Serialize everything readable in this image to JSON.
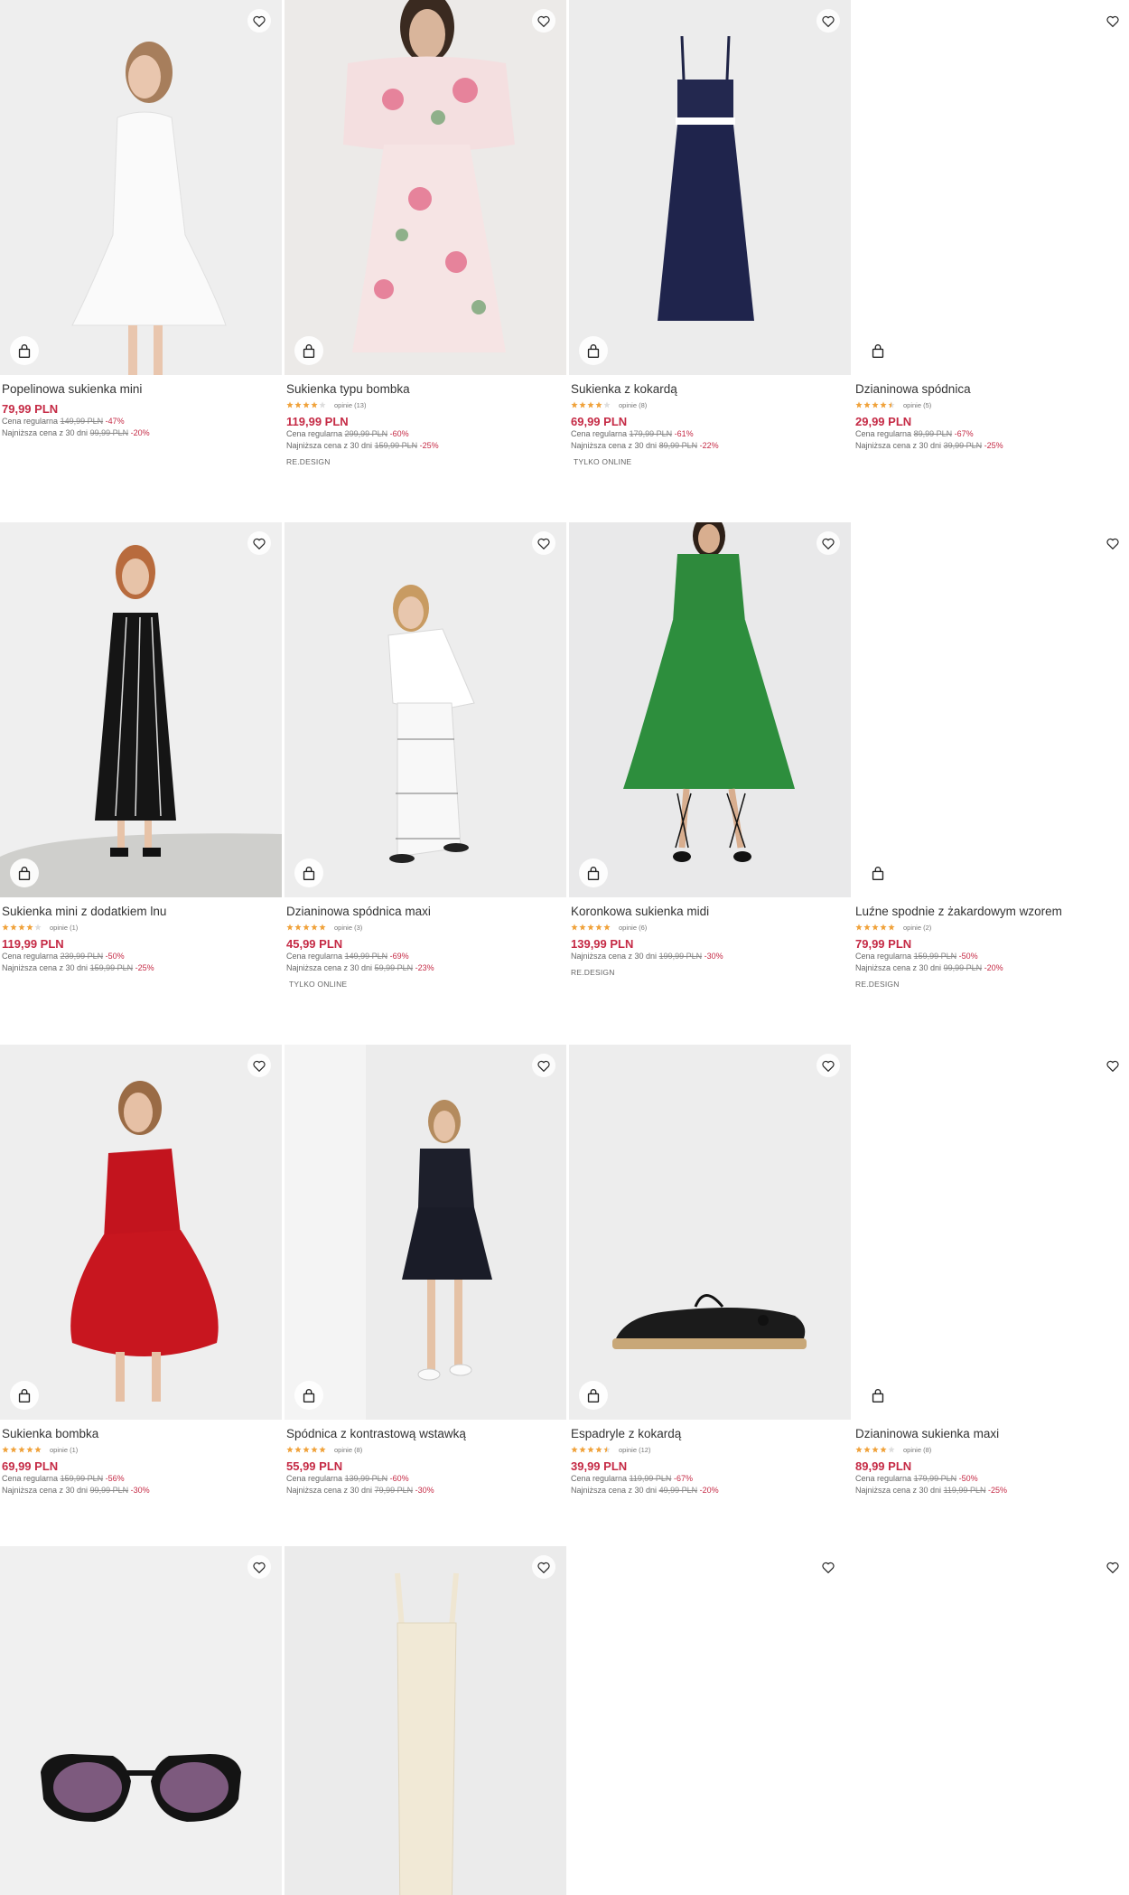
{
  "products": [
    {
      "name": "Popelinowa sukienka mini",
      "stars": 0,
      "reviews": "",
      "price": "79,99 PLN",
      "regular_label": "Cena regularna",
      "regular": "149,99 PLN",
      "regular_disc": "-47%",
      "lowest_label": "Najniższa cena z 30 dni",
      "lowest": "99,99 PLN",
      "lowest_disc": "-20%",
      "tag": ""
    },
    {
      "name": "Sukienka typu bombka",
      "stars": 4,
      "reviews": "opinie (13)",
      "price": "119,99 PLN",
      "regular_label": "Cena regularna",
      "regular": "299,99 PLN",
      "regular_disc": "-60%",
      "lowest_label": "Najniższa cena z 30 dni",
      "lowest": "159,99 PLN",
      "lowest_disc": "-25%",
      "tag": "RE.DESIGN"
    },
    {
      "name": "Sukienka z kokardą",
      "stars": 4,
      "reviews": "opinie (8)",
      "price": "69,99 PLN",
      "regular_label": "Cena regularna",
      "regular": "179,99 PLN",
      "regular_disc": "-61%",
      "lowest_label": "Najniższa cena z 30 dni",
      "lowest": "89,99 PLN",
      "lowest_disc": "-22%",
      "tag": "TYLKO ONLINE"
    },
    {
      "name": "Dzianinowa spódnica",
      "stars": 4.5,
      "reviews": "opinie (5)",
      "price": "29,99 PLN",
      "regular_label": "Cena regularna",
      "regular": "89,99 PLN",
      "regular_disc": "-67%",
      "lowest_label": "Najniższa cena z 30 dni",
      "lowest": "39,99 PLN",
      "lowest_disc": "-25%",
      "tag": ""
    },
    {
      "name": "Sukienka mini z dodatkiem lnu",
      "stars": 4,
      "reviews": "opinie (1)",
      "price": "119,99 PLN",
      "regular_label": "Cena regularna",
      "regular": "239,99 PLN",
      "regular_disc": "-50%",
      "lowest_label": "Najniższa cena z 30 dni",
      "lowest": "159,99 PLN",
      "lowest_disc": "-25%",
      "tag": ""
    },
    {
      "name": "Dzianinowa spódnica maxi",
      "stars": 5,
      "reviews": "opinie (3)",
      "price": "45,99 PLN",
      "regular_label": "Cena regularna",
      "regular": "149,99 PLN",
      "regular_disc": "-69%",
      "lowest_label": "Najniższa cena z 30 dni",
      "lowest": "59,99 PLN",
      "lowest_disc": "-23%",
      "tag": "TYLKO ONLINE"
    },
    {
      "name": "Koronkowa sukienka midi",
      "stars": 5,
      "reviews": "opinie (6)",
      "price": "139,99 PLN",
      "regular_label": "",
      "regular": "",
      "regular_disc": "",
      "lowest_label": "Najniższa cena z 30 dni",
      "lowest": "199,99 PLN",
      "lowest_disc": "-30%",
      "tag": "RE.DESIGN"
    },
    {
      "name": "Luźne spodnie z żakardowym wzorem",
      "stars": 5,
      "reviews": "opinie (2)",
      "price": "79,99 PLN",
      "regular_label": "Cena regularna",
      "regular": "159,99 PLN",
      "regular_disc": "-50%",
      "lowest_label": "Najniższa cena z 30 dni",
      "lowest": "99,99 PLN",
      "lowest_disc": "-20%",
      "tag": "RE.DESIGN"
    },
    {
      "name": "Sukienka bombka",
      "stars": 5,
      "reviews": "opinie (1)",
      "price": "69,99 PLN",
      "regular_label": "Cena regularna",
      "regular": "159,99 PLN",
      "regular_disc": "-56%",
      "lowest_label": "Najniższa cena z 30 dni",
      "lowest": "99,99 PLN",
      "lowest_disc": "-30%",
      "tag": ""
    },
    {
      "name": "Spódnica z kontrastową wstawką",
      "stars": 5,
      "reviews": "opinie (8)",
      "price": "55,99 PLN",
      "regular_label": "Cena regularna",
      "regular": "139,99 PLN",
      "regular_disc": "-60%",
      "lowest_label": "Najniższa cena z 30 dni",
      "lowest": "79,99 PLN",
      "lowest_disc": "-30%",
      "tag": ""
    },
    {
      "name": "Espadryle z kokardą",
      "stars": 4.5,
      "reviews": "opinie (12)",
      "price": "39,99 PLN",
      "regular_label": "Cena regularna",
      "regular": "119,99 PLN",
      "regular_disc": "-67%",
      "lowest_label": "Najniższa cena z 30 dni",
      "lowest": "49,99 PLN",
      "lowest_disc": "-20%",
      "tag": ""
    },
    {
      "name": "Dzianinowa sukienka maxi",
      "stars": 4,
      "reviews": "opinie (8)",
      "price": "89,99 PLN",
      "regular_label": "Cena regularna",
      "regular": "179,99 PLN",
      "regular_disc": "-50%",
      "lowest_label": "Najniższa cena z 30 dni",
      "lowest": "119,99 PLN",
      "lowest_disc": "-25%",
      "tag": ""
    }
  ],
  "colors": {
    "price": "#c52a45",
    "star": "#f0a23b",
    "star_empty": "#dddddd"
  },
  "icons": {
    "favorite": "heart-icon",
    "cart": "shopping-bag-icon"
  }
}
